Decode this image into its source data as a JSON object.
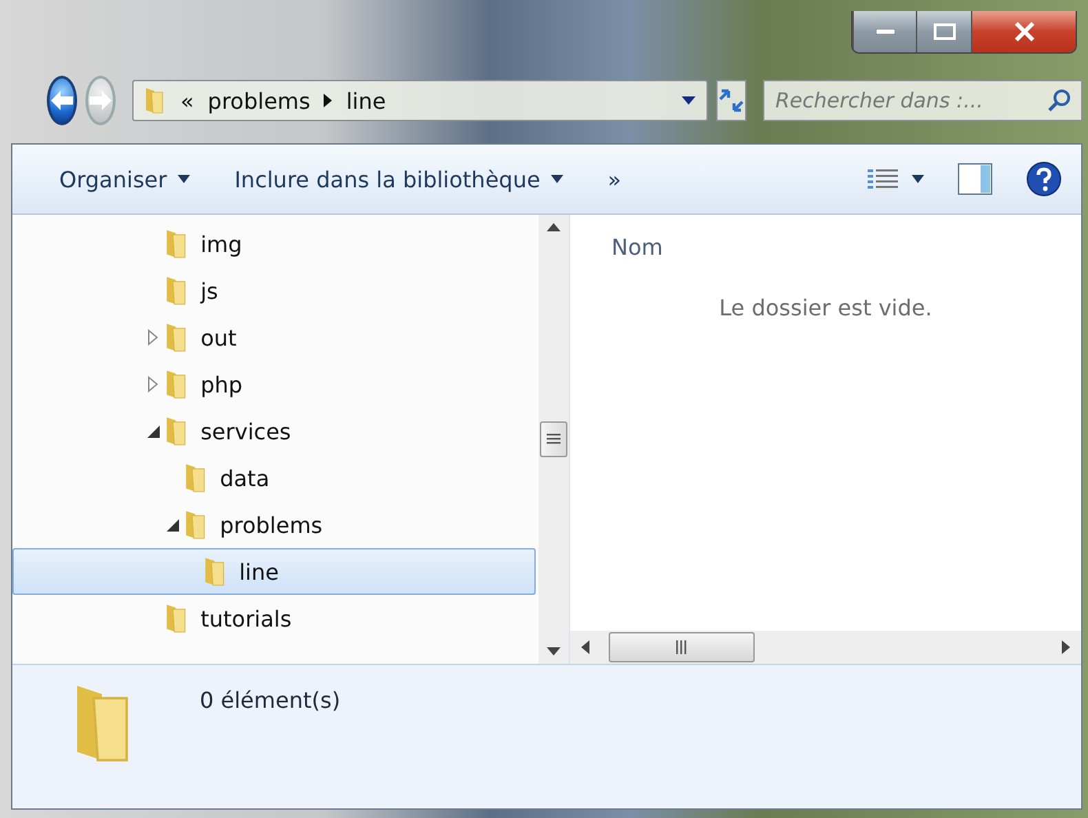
{
  "breadcrumb": {
    "overflow": "«",
    "segments": [
      "problems",
      "line"
    ]
  },
  "search": {
    "placeholder": "Rechercher dans :..."
  },
  "toolbar": {
    "items": [
      {
        "label": "Organiser",
        "dropdown": true
      },
      {
        "label": "Inclure dans la bibliothèque",
        "dropdown": true
      }
    ],
    "more": "»"
  },
  "tree": [
    {
      "label": "img",
      "selected": false
    },
    {
      "label": "js",
      "selected": false
    },
    {
      "label": "out",
      "expanded": false,
      "selected": false
    },
    {
      "label": "php",
      "expanded": false,
      "selected": false
    },
    {
      "label": "services",
      "expanded": true,
      "selected": false,
      "children": [
        {
          "label": "data",
          "selected": false
        },
        {
          "label": "problems",
          "expanded": true,
          "selected": false,
          "children": [
            {
              "label": "line",
              "selected": true
            }
          ]
        }
      ]
    },
    {
      "label": "tutorials",
      "selected": false
    }
  ],
  "content": {
    "column": "Nom",
    "empty_message": "Le dossier est vide."
  },
  "details": {
    "count": "0 élément(s)"
  }
}
